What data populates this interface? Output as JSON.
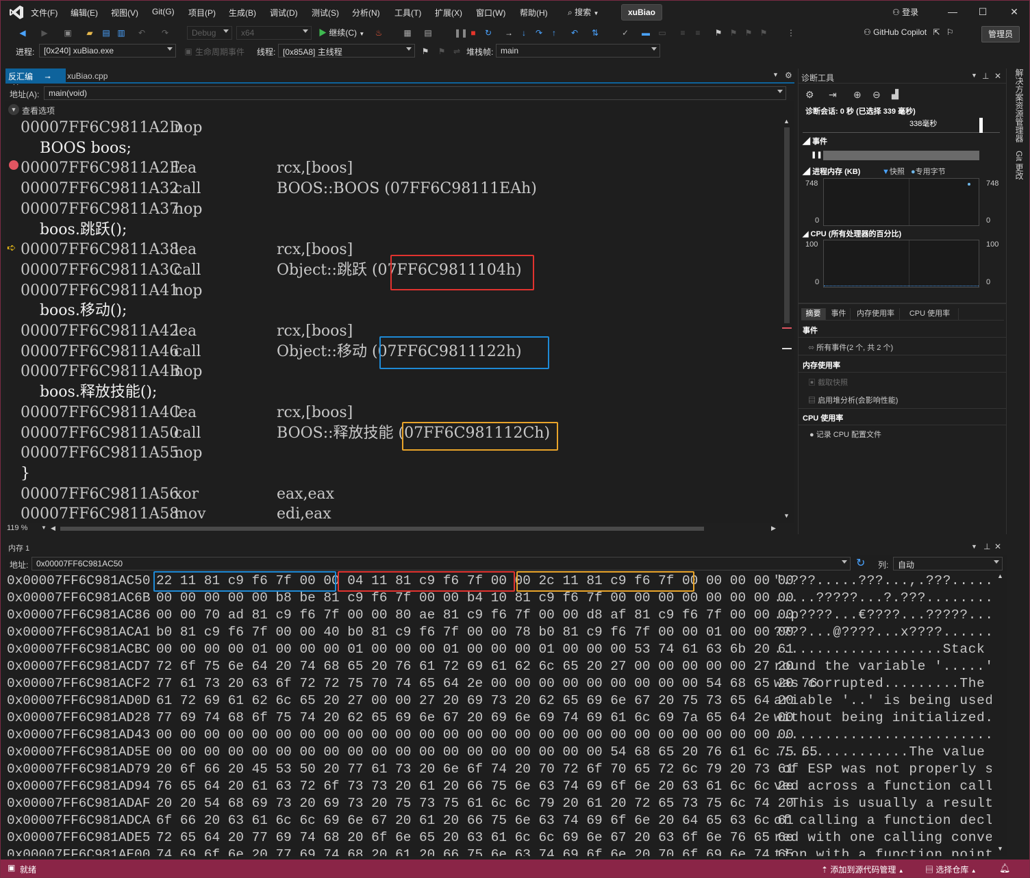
{
  "titlebar": {
    "menus": [
      "文件(F)",
      "编辑(E)",
      "视图(V)",
      "Git(G)",
      "项目(P)",
      "生成(B)",
      "调试(D)",
      "测试(S)",
      "分析(N)",
      "工具(T)",
      "扩展(X)",
      "窗口(W)",
      "帮助(H)"
    ],
    "search": "搜索",
    "solution": "xuBiao",
    "login": "登录"
  },
  "toolbar": {
    "config": "Debug",
    "platform": "x64",
    "continue": "继续(C)",
    "copilot": "GitHub Copilot",
    "admin": "管理员"
  },
  "debugbar": {
    "process_label": "进程:",
    "process_value": "[0x240] xuBiao.exe",
    "lifecycle": "生命周期事件",
    "thread_label": "线程:",
    "thread_value": "[0x85A8] 主线程",
    "stack_label": "堆栈帧:",
    "stack_value": "main"
  },
  "disasm": {
    "tab_active": "反汇编",
    "tab_other": "xuBiao.cpp",
    "address_label": "地址(A):",
    "address_value": "main(void)",
    "view_options": "查看选项",
    "zoom": "119 %",
    "lines": [
      {
        "addr": "00007FF6C9811A2D",
        "op": "nop",
        "arg": ""
      },
      {
        "src": "    BOOS boos;"
      },
      {
        "addr": "00007FF6C9811A2E",
        "op": "lea",
        "arg": "rcx,[boos]"
      },
      {
        "addr": "00007FF6C9811A32",
        "op": "call",
        "arg": "BOOS::BOOS (07FF6C98111EAh)"
      },
      {
        "addr": "00007FF6C9811A37",
        "op": "nop",
        "arg": ""
      },
      {
        "src": "    boos.跳跃();"
      },
      {
        "addr": "00007FF6C9811A38",
        "op": "lea",
        "arg": "rcx,[boos]"
      },
      {
        "addr": "00007FF6C9811A3C",
        "op": "call",
        "arg": "Object::跳跃 (07FF6C9811104h)"
      },
      {
        "addr": "00007FF6C9811A41",
        "op": "nop",
        "arg": ""
      },
      {
        "src": "    boos.移动();"
      },
      {
        "addr": "00007FF6C9811A42",
        "op": "lea",
        "arg": "rcx,[boos]"
      },
      {
        "addr": "00007FF6C9811A46",
        "op": "call",
        "arg": "Object::移动 (07FF6C9811122h)"
      },
      {
        "addr": "00007FF6C9811A4B",
        "op": "nop",
        "arg": ""
      },
      {
        "src": "    boos.释放技能();"
      },
      {
        "addr": "00007FF6C9811A4C",
        "op": "lea",
        "arg": "rcx,[boos]"
      },
      {
        "addr": "00007FF6C9811A50",
        "op": "call",
        "arg": "BOOS::释放技能 (07FF6C981112Ch)"
      },
      {
        "addr": "00007FF6C9811A55",
        "op": "nop",
        "arg": ""
      },
      {
        "src": "}"
      },
      {
        "addr": "00007FF6C9811A56",
        "op": "xor",
        "arg": "eax,eax"
      },
      {
        "addr": "00007FF6C9811A58",
        "op": "mov",
        "arg": "edi,eax"
      }
    ]
  },
  "diag": {
    "title": "诊断工具",
    "session": "诊断会话: 0 秒 (已选择 339 毫秒)",
    "timeline": "338毫秒",
    "events": "事件",
    "mem_title": "进程内存 (KB)",
    "snapshot": "快照",
    "private_bytes": "专用字节",
    "mem_max": "748",
    "mem_min": "0",
    "cpu_title": "CPU (所有处理器的百分比)",
    "cpu_max": "100",
    "cpu_min": "0",
    "tabs": [
      "摘要",
      "事件",
      "内存使用率",
      "CPU 使用率"
    ],
    "sec_events": "事件",
    "all_events": "所有事件(2 个, 共 2 个)",
    "sec_mem": "内存使用率",
    "take_snapshot": "截取快照",
    "heap_profile": "启用堆分析(会影响性能)",
    "sec_cpu": "CPU 使用率",
    "record_cpu": "记录 CPU 配置文件"
  },
  "sidebar": {
    "solution_explorer": "解决方案资源管理器",
    "git": "Git 更改"
  },
  "memory": {
    "title": "内存 1",
    "address_label": "地址:",
    "address_value": "0x00007FF6C981AC50",
    "columns_label": "列:",
    "columns_value": "自动",
    "rows": [
      {
        "addr": "0x00007FF6C981AC50",
        "hex": "22 11 81 c9 f6 7f 00 00 04 11 81 c9 f6 7f 00 00 2c 11 81 c9 f6 7f 00 00 00 00 00",
        "ascii": "\".???.....???...,.???......"
      },
      {
        "addr": "0x00007FF6C981AC6B",
        "hex": "00 00 00 00 00 b8 be 81 c9 f6 7f 00 00 b4 10 81 c9 f6 7f 00 00 00 00 00 00 00 00",
        "ascii": ".....?????...?.???........."
      },
      {
        "addr": "0x00007FF6C981AC86",
        "hex": "00 00 70 ad 81 c9 f6 7f 00 00 80 ae 81 c9 f6 7f 00 00 d8 af 81 c9 f6 7f 00 00 00",
        "ascii": "..p????...€????...?????...."
      },
      {
        "addr": "0x00007FF6C981ACA1",
        "hex": "b0 81 c9 f6 7f 00 00 40 b0 81 c9 f6 7f 00 00 78 b0 81 c9 f6 7f 00 00 01 00 00 00",
        "ascii": "????...@????...x????......."
      },
      {
        "addr": "0x00007FF6C981ACBC",
        "hex": "00 00 00 00 01 00 00 00 01 00 00 00 01 00 00 00 01 00 00 00 53 74 61 63 6b 20 61",
        "ascii": "....................Stack a"
      },
      {
        "addr": "0x00007FF6C981ACD7",
        "hex": "72 6f 75 6e 64 20 74 68 65 20 76 61 72 69 61 62 6c 65 20 27 00 00 00 00 00 27 20",
        "ascii": "round the variable '.....' "
      },
      {
        "addr": "0x00007FF6C981ACF2",
        "hex": "77 61 73 20 63 6f 72 72 75 70 74 65 64 2e 00 00 00 00 00 00 00 00 00 54 68 65 20 76",
        "ascii": "was corrupted.........The v"
      },
      {
        "addr": "0x00007FF6C981AD0D",
        "hex": "61 72 69 61 62 6c 65 20 27 00 00 27 20 69 73 20 62 65 69 6e 67 20 75 73 65 64 20",
        "ascii": "ariable '..' is being used "
      },
      {
        "addr": "0x00007FF6C981AD28",
        "hex": "77 69 74 68 6f 75 74 20 62 65 69 6e 67 20 69 6e 69 74 69 61 6c 69 7a 65 64 2e 00",
        "ascii": "without being initialized.."
      },
      {
        "addr": "0x00007FF6C981AD43",
        "hex": "00 00 00 00 00 00 00 00 00 00 00 00 00 00 00 00 00 00 00 00 00 00 00 00 00 00 00",
        "ascii": "..........................."
      },
      {
        "addr": "0x00007FF6C981AD5E",
        "hex": "00 00 00 00 00 00 00 00 00 00 00 00 00 00 00 00 00 00 00 54 68 65 20 76 61 6c 75 65",
        "ascii": "................The value"
      },
      {
        "addr": "0x00007FF6C981AD79",
        "hex": "20 6f 66 20 45 53 50 20 77 61 73 20 6e 6f 74 20 70 72 6f 70 65 72 6c 79 20 73 61",
        "ascii": " of ESP was not properly sa"
      },
      {
        "addr": "0x00007FF6C981AD94",
        "hex": "76 65 64 20 61 63 72 6f 73 73 20 61 20 66 75 6e 63 74 69 6f 6e 20 63 61 6c 6c 2e",
        "ascii": "ved across a function call."
      },
      {
        "addr": "0x00007FF6C981ADAF",
        "hex": "20 20 54 68 69 73 20 69 73 20 75 73 75 61 6c 6c 79 20 61 20 72 65 73 75 6c 74 20",
        "ascii": "  This is usually a result "
      },
      {
        "addr": "0x00007FF6C981ADCA",
        "hex": "6f 66 20 63 61 6c 6c 69 6e 67 20 61 20 66 75 6e 63 74 69 6f 6e 20 64 65 63 6c 61",
        "ascii": "of calling a function decla"
      },
      {
        "addr": "0x00007FF6C981ADE5",
        "hex": "72 65 64 20 77 69 74 68 20 6f 6e 65 20 63 61 6c 6c 69 6e 67 20 63 6f 6e 76 65 6e",
        "ascii": "red with one calling conven"
      },
      {
        "addr": "0x00007FF6C981AE00",
        "hex": "74 69 6f 6e 20 77 69 74 68 20 61 20 66 75 6e 63 74 69 6f 6e 20 70 6f 69 6e 74 65",
        "ascii": "tion with a function pointe"
      }
    ]
  },
  "status": {
    "ready": "就绪",
    "source_control": "添加到源代码管理",
    "repo": "选择仓库"
  },
  "colors": {
    "accent": "#0e639c",
    "status_bar": "#8a2547",
    "box_red": "#e2332f",
    "box_blue": "#1e8ad6",
    "box_orange": "#e9a42a",
    "breakpoint": "#e05561"
  }
}
